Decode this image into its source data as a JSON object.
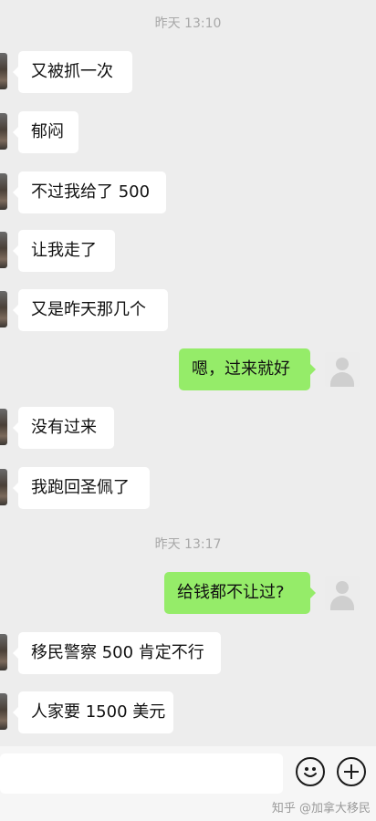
{
  "messages": [
    {
      "type": "timestamp",
      "text": "昨天 13:10"
    },
    {
      "type": "in",
      "text": "又被抓一次"
    },
    {
      "type": "in",
      "text": "郁闷"
    },
    {
      "type": "in",
      "text": "不过我给了 500"
    },
    {
      "type": "in",
      "text": "让我走了"
    },
    {
      "type": "in",
      "text": "又是昨天那几个"
    },
    {
      "type": "out",
      "text": "嗯，过来就好"
    },
    {
      "type": "in",
      "text": "没有过来"
    },
    {
      "type": "in",
      "text": "我跑回圣佩了"
    },
    {
      "type": "timestamp",
      "text": "昨天 13:17"
    },
    {
      "type": "out",
      "text": "给钱都不让过?"
    },
    {
      "type": "in",
      "text": "移民警察 500 肯定不行"
    },
    {
      "type": "in",
      "text": "人家要 1500 美元"
    }
  ],
  "input": {
    "value": ""
  },
  "icons": {
    "emoji": "smiley-icon",
    "more": "plus-icon",
    "avatar": "default-avatar-icon"
  },
  "watermark": "知乎 @加拿大移民",
  "colors": {
    "background": "#ededed",
    "incoming": "#ffffff",
    "outgoing": "#95ec69",
    "timestamp": "#a8a8a8"
  }
}
